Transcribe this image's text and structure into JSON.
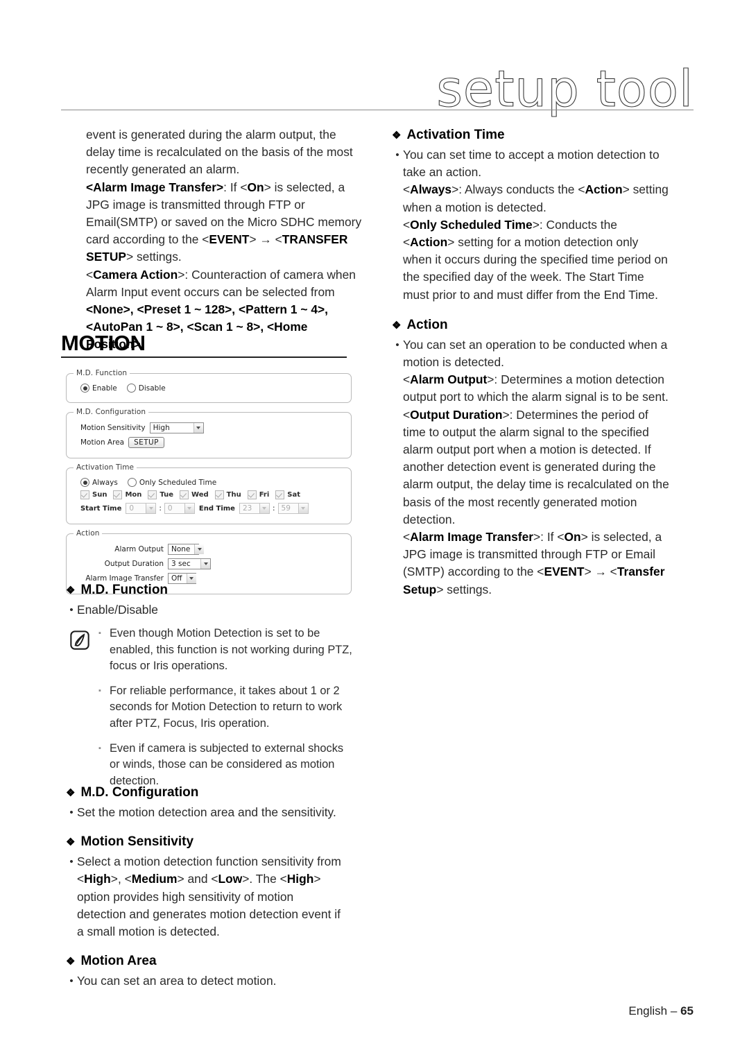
{
  "header": {
    "title": "setup tool"
  },
  "left_column": {
    "intro_paragraph_html": "event is generated during the alarm output, the delay time is recalculated on the basis of the most recently generated an alarm.<br><b>&lt;Alarm Image Transfer&gt;</b>: If &lt;<b>On</b>&gt; is selected, a JPG image is transmitted through FTP or Email(SMTP) or saved on the Micro SDHC memory card according to the &lt;<b>EVENT</b>&gt; &rarr; &lt;<b>TRANSFER SETUP</b>&gt; settings.<br>&lt;<b>Camera Action</b>&gt;: Counteraction of camera when Alarm Input event occurs can be selected from <b>&lt;None&gt;, &lt;Preset 1 ~ 128&gt;, &lt;Pattern 1 ~ 4&gt;, &lt;AutoPan 1 ~ 8&gt;, &lt;Scan 1 ~ 8&gt;, &lt;Home Position&gt;</b>."
  },
  "section": {
    "title": "MOTION"
  },
  "dialog": {
    "md_function": {
      "legend": "M.D. Function",
      "options": [
        {
          "label": "Enable",
          "selected": true
        },
        {
          "label": "Disable",
          "selected": false
        }
      ]
    },
    "md_configuration": {
      "legend": "M.D. Configuration",
      "motion_sensitivity_label": "Motion Sensitivity",
      "motion_sensitivity_value": "High",
      "motion_area_label": "Motion Area",
      "motion_area_button": "SETUP"
    },
    "activation_time": {
      "legend": "Activation Time",
      "options": [
        {
          "label": "Always",
          "selected": true
        },
        {
          "label": "Only Scheduled Time",
          "selected": false
        }
      ],
      "days": [
        {
          "label": "Sun",
          "checked": true
        },
        {
          "label": "Mon",
          "checked": true
        },
        {
          "label": "Tue",
          "checked": true
        },
        {
          "label": "Wed",
          "checked": true
        },
        {
          "label": "Thu",
          "checked": true
        },
        {
          "label": "Fri",
          "checked": true
        },
        {
          "label": "Sat",
          "checked": true
        }
      ],
      "start_time_label": "Start Time",
      "start_hour": "0",
      "start_minute": "0",
      "end_time_label": "End Time",
      "end_hour": "23",
      "end_minute": "59",
      "time_separator": ":"
    },
    "action": {
      "legend": "Action",
      "alarm_output_label": "Alarm Output",
      "alarm_output_value": "None",
      "output_duration_label": "Output Duration",
      "output_duration_value": "3 sec",
      "alarm_image_transfer_label": "Alarm Image Transfer",
      "alarm_image_transfer_value": "Off"
    }
  },
  "left_sections": {
    "md_function": {
      "heading": "M.D. Function",
      "bullet": "Enable/Disable"
    },
    "notes": [
      "Even though Motion Detection is set to be enabled, this function is not working during PTZ, focus or Iris operations.",
      "For reliable performance, it takes about 1 or 2 seconds for Motion Detection to return to work after PTZ, Focus, Iris operation.",
      "Even if camera is subjected to external shocks or winds, those can be considered as motion detection."
    ],
    "md_configuration": {
      "heading": "M.D. Configuration",
      "bullet": "Set the motion detection area and the sensitivity."
    },
    "motion_sensitivity": {
      "heading": "Motion Sensitivity",
      "bullet_html": "Select a motion detection function sensitivity from &lt;<b>High</b>&gt;, &lt;<b>Medium</b>&gt; and &lt;<b>Low</b>&gt;. The &lt;<b>High</b>&gt; option provides high sensitivity of motion detection and generates motion detection event if a small motion is detected."
    },
    "motion_area": {
      "heading": "Motion Area",
      "bullet": "You can set an area to detect motion."
    }
  },
  "right_sections": {
    "activation_time": {
      "heading": "Activation Time",
      "bullet_html": "You can set time to accept a motion detection to take an action.<br>&lt;<b>Always</b>&gt;: Always conducts the &lt;<b>Action</b>&gt; setting when a motion is detected.<br>&lt;<b>Only Scheduled Time</b>&gt;: Conducts the &lt;<b>Action</b>&gt; setting for a motion detection only when it occurs during the specified time period on the specified day of the week. The Start Time must prior to and must differ from the End Time."
    },
    "action": {
      "heading": "Action",
      "bullet_html": "You can set an operation to be conducted when a motion is detected.<br>&lt;<b>Alarm Output</b>&gt;: Determines a motion detection output port to which the alarm signal is to be sent.<br>&lt;<b>Output Duration</b>&gt;: Determines the period of time to output the alarm signal to the specified alarm output port when a motion is detected. If another detection event is generated during the alarm output, the delay time is recalculated on the basis of the most recently generated motion detection.<br>&lt;<b>Alarm Image Transfer</b>&gt;: If &lt;<b>On</b>&gt; is selected, a JPG image is transmitted through FTP or Email (SMTP) according to the &lt;<b>EVENT</b>&gt; &rarr; &lt;<b>Transfer Setup</b>&gt; settings."
    }
  },
  "footer": {
    "language": "English",
    "dash": "–",
    "page": "65"
  },
  "icons": {
    "diamond_marker": "❖",
    "bullet_dot": "•",
    "note_square": "▪"
  }
}
